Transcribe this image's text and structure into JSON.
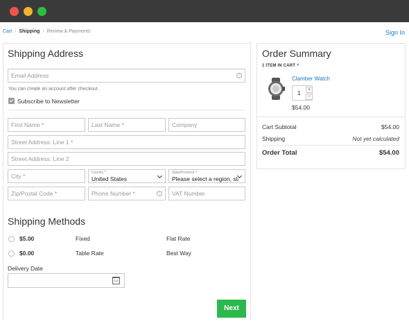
{
  "window": {
    "controls": [
      "close",
      "minimize",
      "maximize"
    ]
  },
  "breadcrumb": {
    "cart": "Cart",
    "sep": "›",
    "shipping": "Shipping",
    "review": "Review & Payments"
  },
  "header": {
    "signin": "Sign In"
  },
  "shipping_address": {
    "title": "Shipping Address",
    "email_placeholder": "Email Address",
    "email_hint": "You can create an account after checkout.",
    "subscribe_label": "Subscribe to Newsletter",
    "subscribe_checked": true,
    "first_name": "First Name *",
    "last_name": "Last Name *",
    "company": "Company",
    "street1": "Street Address: Line 1 *",
    "street2": "Street Address: Line 2",
    "city": "City *",
    "country_label": "Country *",
    "country_value": "United States",
    "state_label": "State/Province *",
    "state_value": "Please select a region, state or province.",
    "zip": "Zip/Postal Code *",
    "phone": "Phone Number *",
    "vat": "VAT Number"
  },
  "shipping_methods": {
    "title": "Shipping Methods",
    "methods": [
      {
        "price": "$5.00",
        "method": "Fixed",
        "carrier": "Flat Rate"
      },
      {
        "price": "$0.00",
        "method": "Table Rate",
        "carrier": "Best Way"
      }
    ],
    "delivery_label": "Delivery Date",
    "next_label": "Next"
  },
  "order_summary": {
    "title": "Order Summary",
    "items_count": "1 ITEM IN CART ^",
    "product": {
      "name": "Clamber Watch",
      "qty": "1",
      "price": "$54.00"
    },
    "subtotal_label": "Cart Subtotal",
    "subtotal_value": "$54.00",
    "shipping_label": "Shipping",
    "shipping_value": "Not yet calculated",
    "total_label": "Order Total",
    "total_value": "$54.00"
  },
  "colors": {
    "accent_link": "#1979c3",
    "next_button": "#2db84d",
    "titlebar": "#3a3a3a"
  }
}
